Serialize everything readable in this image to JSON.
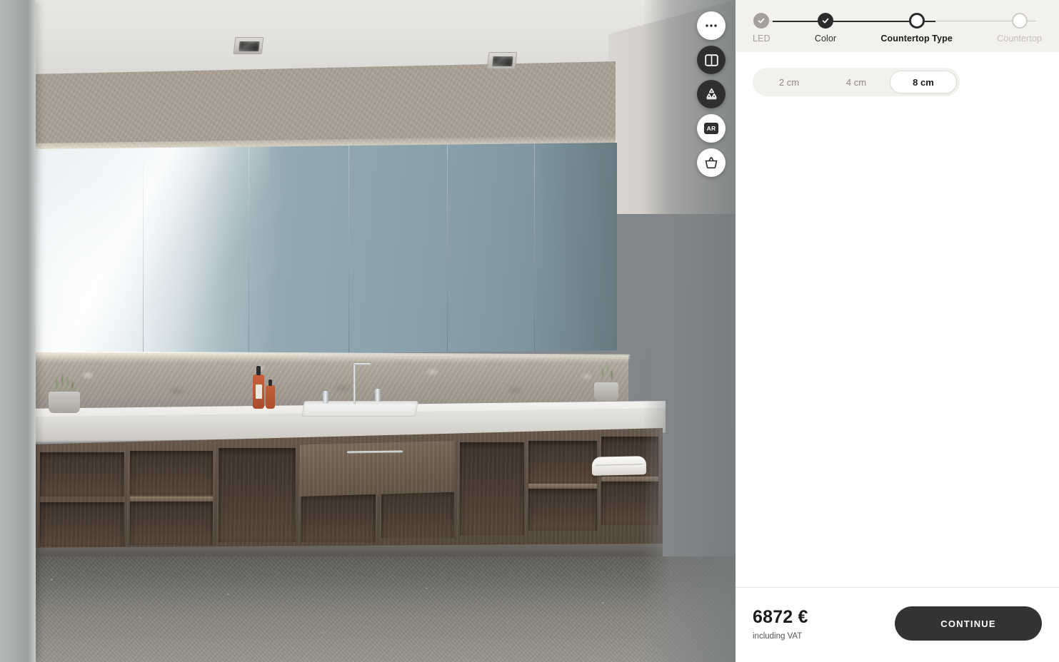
{
  "viewport": {
    "scene_name": "bathroom-vanity-render",
    "fabs": [
      {
        "name": "more-options",
        "icon": "ellipsis-icon",
        "style": "light"
      },
      {
        "name": "compare-view",
        "icon": "split-view-icon",
        "style": "dark"
      },
      {
        "name": "sustainability",
        "icon": "recycle-icon",
        "style": "dark"
      },
      {
        "name": "view-in-ar",
        "icon": "ar-icon",
        "style": "light",
        "badge": "AR"
      },
      {
        "name": "add-to-basket",
        "icon": "basket-icon",
        "style": "light"
      }
    ]
  },
  "panel": {
    "stepper": {
      "steps": [
        {
          "label": "LED",
          "state": "done-muted"
        },
        {
          "label": "Color",
          "state": "done"
        },
        {
          "label": "Countertop Type",
          "state": "current"
        },
        {
          "label": "Countertop",
          "state": "upcoming"
        }
      ]
    },
    "options": {
      "segmented": [
        {
          "label": "2 cm",
          "selected": false
        },
        {
          "label": "4 cm",
          "selected": false
        },
        {
          "label": "8 cm",
          "selected": true
        }
      ]
    },
    "footer": {
      "price": "6872 €",
      "price_note": "including VAT",
      "continue_label": "CONTINUE"
    }
  },
  "colors": {
    "accent_dark": "#2b2b2b",
    "button_dark": "#333331",
    "header_bg": "#f2f1ed",
    "muted_text": "#a3a09b",
    "upcoming_text": "#c4c1bc"
  }
}
